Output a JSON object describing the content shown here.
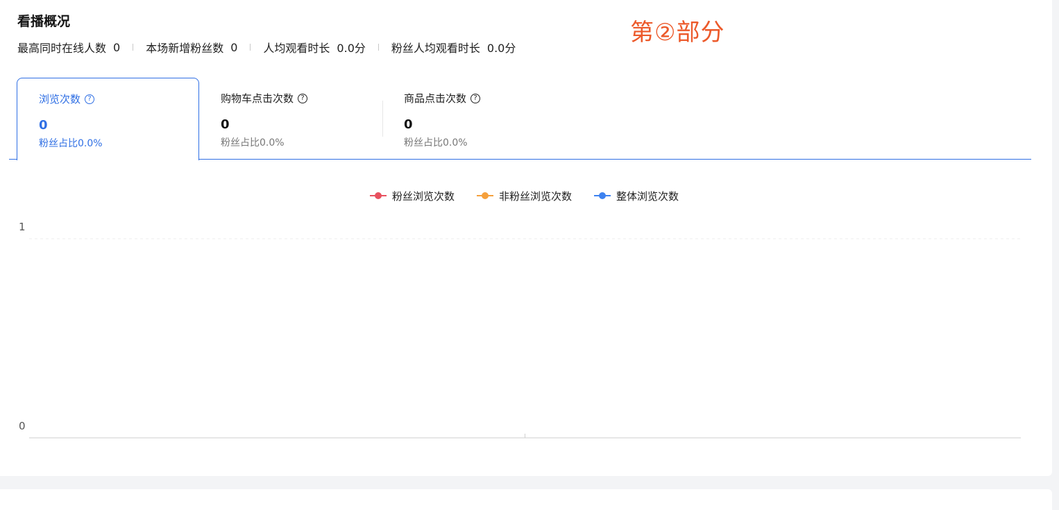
{
  "section": {
    "title": "看播概况",
    "annotation": "第②部分"
  },
  "stats": [
    {
      "label": "最高同时在线人数",
      "value": "0"
    },
    {
      "label": "本场新增粉丝数",
      "value": "0"
    },
    {
      "label": "人均观看时长",
      "value": "0.0分"
    },
    {
      "label": "粉丝人均观看时长",
      "value": "0.0分"
    }
  ],
  "tabs": [
    {
      "label": "浏览次数",
      "value": "0",
      "sub": "粉丝占比0.0%",
      "active": true,
      "icon": "help-circle-icon"
    },
    {
      "label": "购物车点击次数",
      "value": "0",
      "sub": "粉丝占比0.0%",
      "active": false,
      "icon": "help-circle-icon"
    },
    {
      "label": "商品点击次数",
      "value": "0",
      "sub": "粉丝占比0.0%",
      "active": false,
      "icon": "help-circle-icon"
    }
  ],
  "colors": {
    "accent": "#2f6fe4",
    "annotation": "#ec5a2b",
    "series_fans": "#e8515f",
    "series_non_fans": "#f5a03c",
    "series_total": "#3d82f0"
  },
  "chart_data": {
    "type": "line",
    "title": "",
    "xlabel": "",
    "ylabel": "",
    "ylim": [
      0,
      1
    ],
    "yticks": [
      "0",
      "1"
    ],
    "grid": true,
    "legend": "top-center",
    "series": [
      {
        "name": "粉丝浏览次数",
        "values": []
      },
      {
        "name": "非粉丝浏览次数",
        "values": []
      },
      {
        "name": "整体浏览次数",
        "values": []
      }
    ]
  }
}
